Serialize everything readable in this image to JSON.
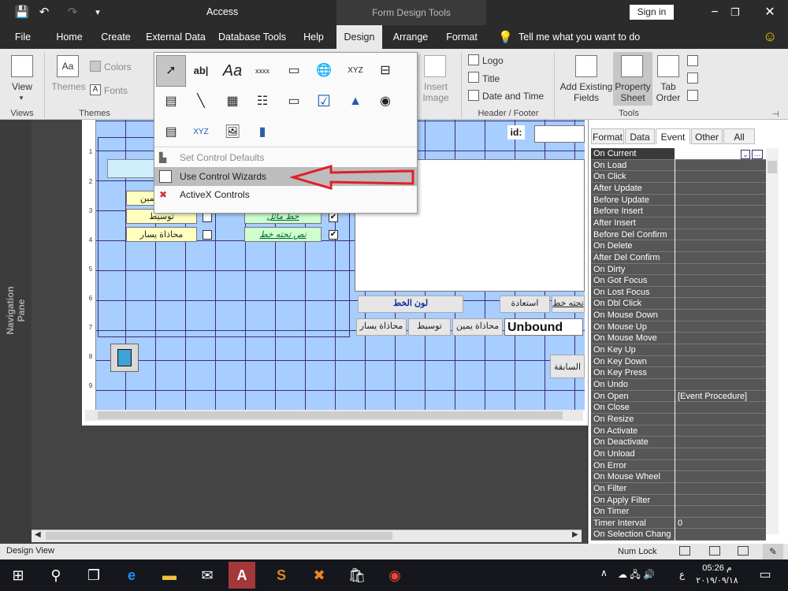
{
  "window": {
    "app_title": "Access",
    "context_title": "Form Design Tools",
    "sign_in": "Sign in",
    "min": "−",
    "restore": "❐",
    "close": "✕"
  },
  "qat": {
    "save": "💾",
    "undo": "↶",
    "redo": "↷",
    "customize": "▾"
  },
  "tabs": [
    "File",
    "Home",
    "Create",
    "External Data",
    "Database Tools",
    "Help",
    "Design",
    "Arrange",
    "Format"
  ],
  "tell_me": "Tell me what you want to do",
  "tell_me_icon": "lightbulb-icon",
  "smiley": "☺",
  "ribbon": {
    "view": {
      "label": "View",
      "group": "Views"
    },
    "themes": {
      "themes_label": "Themes",
      "colors_label": "Colors",
      "fonts_label": "Fonts",
      "group": "Themes"
    },
    "insert_image": "Insert Image",
    "header_footer": {
      "logo": "Logo",
      "title": "Title",
      "date_time": "Date and Time",
      "group": "Header / Footer"
    },
    "tools": {
      "add_existing": "Add Existing Fields",
      "property_sheet": "Property Sheet",
      "tab_order": "Tab Order",
      "group": "Tools"
    }
  },
  "controls_menu": {
    "items": [
      "Set Control Defaults",
      "Use Control Wizards",
      "ActiveX Controls"
    ],
    "tiles": {
      "textbox": "ab|",
      "label": "Aa",
      "button": "xxxx",
      "xyz": "XYZ"
    }
  },
  "nav_pane": "Navigation Pane",
  "form": {
    "ruler": [
      "1",
      "2",
      "3",
      "4",
      "5",
      "6",
      "7",
      "8",
      "9"
    ],
    "id_label": "id:",
    "yellow_buttons": [
      "محاذاة يمين",
      "توسيط",
      "محاذاة يسار"
    ],
    "green_buttons": [
      "خط مائل",
      "نص تحته خط"
    ],
    "font_color": "لون الخط",
    "restore": "استعادة",
    "underline_right": "تحته خط",
    "align_left": "محاذاة يسار",
    "center": "توسيط",
    "align_right": "محاذاة يمين",
    "unbound": "Unbound",
    "previous": "السابقة"
  },
  "property_sheet": {
    "tabs": [
      "Format",
      "Data",
      "Event",
      "Other",
      "All"
    ],
    "active_tab": "Event",
    "rows": [
      {
        "name": "On Current",
        "value": ""
      },
      {
        "name": "On Load",
        "value": ""
      },
      {
        "name": "On Click",
        "value": ""
      },
      {
        "name": "After Update",
        "value": ""
      },
      {
        "name": "Before Update",
        "value": ""
      },
      {
        "name": "Before Insert",
        "value": ""
      },
      {
        "name": "After Insert",
        "value": ""
      },
      {
        "name": "Before Del Confirm",
        "value": ""
      },
      {
        "name": "On Delete",
        "value": ""
      },
      {
        "name": "After Del Confirm",
        "value": ""
      },
      {
        "name": "On Dirty",
        "value": ""
      },
      {
        "name": "On Got Focus",
        "value": ""
      },
      {
        "name": "On Lost Focus",
        "value": ""
      },
      {
        "name": "On Dbl Click",
        "value": ""
      },
      {
        "name": "On Mouse Down",
        "value": ""
      },
      {
        "name": "On Mouse Up",
        "value": ""
      },
      {
        "name": "On Mouse Move",
        "value": ""
      },
      {
        "name": "On Key Up",
        "value": ""
      },
      {
        "name": "On Key Down",
        "value": ""
      },
      {
        "name": "On Key Press",
        "value": ""
      },
      {
        "name": "On Undo",
        "value": ""
      },
      {
        "name": "On Open",
        "value": "[Event Procedure]"
      },
      {
        "name": "On Close",
        "value": ""
      },
      {
        "name": "On Resize",
        "value": ""
      },
      {
        "name": "On Activate",
        "value": ""
      },
      {
        "name": "On Deactivate",
        "value": ""
      },
      {
        "name": "On Unload",
        "value": ""
      },
      {
        "name": "On Error",
        "value": ""
      },
      {
        "name": "On Mouse Wheel",
        "value": ""
      },
      {
        "name": "On Filter",
        "value": ""
      },
      {
        "name": "On Apply Filter",
        "value": ""
      },
      {
        "name": "On Timer",
        "value": ""
      },
      {
        "name": "Timer Interval",
        "value": "0"
      },
      {
        "name": "On Selection Chang",
        "value": ""
      }
    ]
  },
  "status": {
    "left": "Design View",
    "num_lock": "Num Lock"
  },
  "taskbar": {
    "time": "05:26 م",
    "date": "٢٠١٩/٠٩/١٨",
    "lang": "ع"
  },
  "colors": {
    "accent": "#a4373a",
    "grid": "#a8cdff",
    "arrow": "#e0202a"
  }
}
